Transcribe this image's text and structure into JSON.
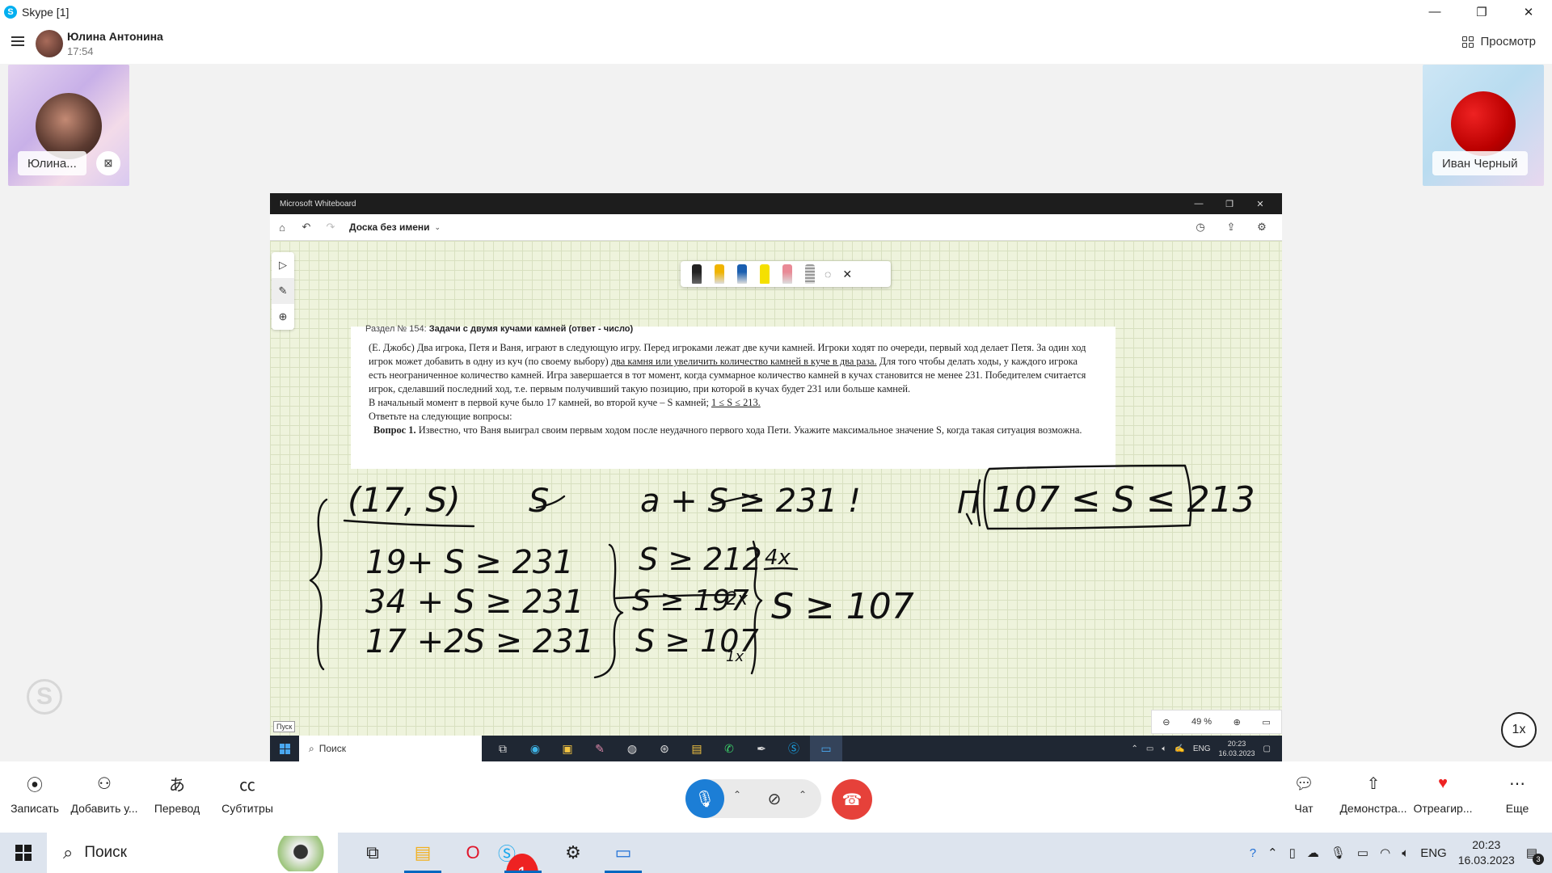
{
  "window": {
    "title": "Skype [1]"
  },
  "header": {
    "contact_name": "Юлина Антонина",
    "call_time": "17:54",
    "view_label": "Просмотр"
  },
  "participants": [
    {
      "name": "Юлина..."
    },
    {
      "name": "Иван Черный"
    }
  ],
  "whiteboard": {
    "app_title": "Microsoft Whiteboard",
    "board_name": "Доска без имени",
    "zoom": "49 %",
    "start_tip": "Пуск",
    "doc": {
      "section_label": "Раздел № 154:",
      "section_title": "Задачи с двумя кучами камней (ответ - число)",
      "para1_a": "(Е. Джобс) Два игрока, Петя и Ваня, играют в следующую игру. Перед игроками лежат две кучи камней. Игроки ходят по очереди, первый ход делает Петя. За один ход игрок может добавить в одну из куч (по своему выбору)",
      "para1_u": "два камня или увеличить количество камней в куче в два раза.",
      "para1_b": "Для того чтобы делать ходы, у каждого игрока есть неограниченное количество камней. Игра завершается в тот момент, когда суммарное количество камней в кучах становится не менее 231. Победителем считается игрок, сделавший последний ход, т.е. первым получивший такую позицию, при которой в кучах будет 231 или больше камней.",
      "para2_a": "В начальный момент в первой куче было 17 камней, во второй куче – S камней;",
      "para2_u": "1 ≤ S ≤ 213.",
      "para3": "Ответьте на следующие вопросы:",
      "q1_label": "Вопрос 1.",
      "q1_text": "Известно, что Ваня выиграл своим первым ходом после неудачного первого хода Пети. Укажите максимальное значение S, когда такая ситуация возможна."
    },
    "inner_taskbar": {
      "search": "Поиск",
      "lang": "ENG",
      "time": "20:23",
      "date": "16.03.2023"
    }
  },
  "speed_label": "1x",
  "callbar": {
    "record": "Записать",
    "add_user": "Добавить у...",
    "translate": "Перевод",
    "subtitles": "Субтитры",
    "chat": "Чат",
    "share": "Демонстра...",
    "react": "Отреагир...",
    "more": "Еще"
  },
  "taskbar": {
    "search": "Поиск",
    "lang": "ENG",
    "time": "20:23",
    "date": "16.03.2023",
    "skype_badge": "1",
    "notif_count": "3"
  }
}
